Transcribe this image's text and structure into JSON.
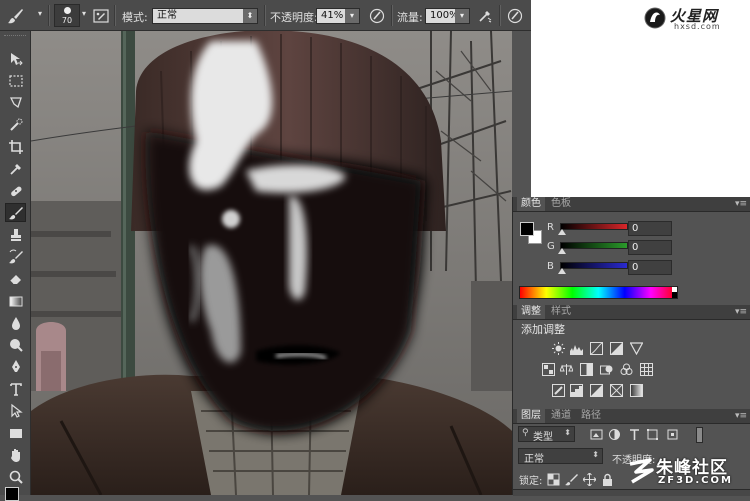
{
  "options_bar": {
    "brush_size": "70",
    "mode_label": "模式:",
    "mode_value": "正常",
    "opacity_label": "不透明度:",
    "opacity_value": "41%",
    "flow_label": "流量:",
    "flow_value": "100%"
  },
  "logo": {
    "main_text": "火星网",
    "sub_text": "hxsd.com"
  },
  "color_panel": {
    "tabs": [
      "颜色",
      "色板"
    ],
    "sliders": [
      {
        "name": "R",
        "value": "0",
        "color": "#d8262a"
      },
      {
        "name": "G",
        "value": "0",
        "color": "#2a9a2a"
      },
      {
        "name": "B",
        "value": "0",
        "color": "#2a2ad0"
      }
    ],
    "foreground_color": "#000000",
    "background_color": "#ffffff"
  },
  "adjustments_panel": {
    "tabs": [
      "调整",
      "样式"
    ],
    "heading": "添加调整"
  },
  "layers_panel": {
    "tabs": [
      "图层",
      "通道",
      "路径"
    ],
    "filter_label": "类型",
    "blend_mode": "正常",
    "opacity_label": "不透明度:",
    "lock_label": "锁定:"
  },
  "watermark": {
    "main_text": "朱峰社区",
    "sub_text": "ZF3D.COM"
  }
}
